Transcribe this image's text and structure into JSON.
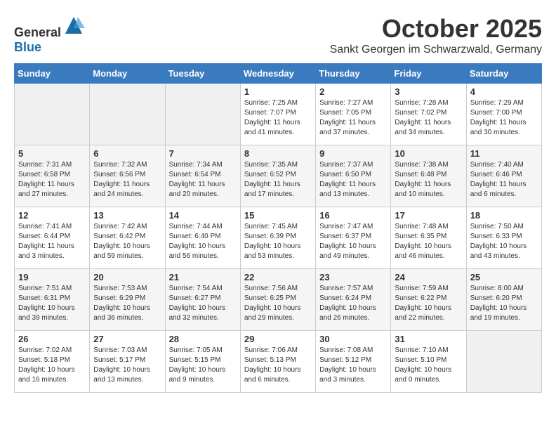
{
  "logo": {
    "text_general": "General",
    "text_blue": "Blue"
  },
  "header": {
    "month": "October 2025",
    "location": "Sankt Georgen im Schwarzwald, Germany"
  },
  "weekdays": [
    "Sunday",
    "Monday",
    "Tuesday",
    "Wednesday",
    "Thursday",
    "Friday",
    "Saturday"
  ],
  "weeks": [
    [
      {
        "day": "",
        "info": ""
      },
      {
        "day": "",
        "info": ""
      },
      {
        "day": "",
        "info": ""
      },
      {
        "day": "1",
        "info": "Sunrise: 7:25 AM\nSunset: 7:07 PM\nDaylight: 11 hours\nand 41 minutes."
      },
      {
        "day": "2",
        "info": "Sunrise: 7:27 AM\nSunset: 7:05 PM\nDaylight: 11 hours\nand 37 minutes."
      },
      {
        "day": "3",
        "info": "Sunrise: 7:28 AM\nSunset: 7:02 PM\nDaylight: 11 hours\nand 34 minutes."
      },
      {
        "day": "4",
        "info": "Sunrise: 7:29 AM\nSunset: 7:00 PM\nDaylight: 11 hours\nand 30 minutes."
      }
    ],
    [
      {
        "day": "5",
        "info": "Sunrise: 7:31 AM\nSunset: 6:58 PM\nDaylight: 11 hours\nand 27 minutes."
      },
      {
        "day": "6",
        "info": "Sunrise: 7:32 AM\nSunset: 6:56 PM\nDaylight: 11 hours\nand 24 minutes."
      },
      {
        "day": "7",
        "info": "Sunrise: 7:34 AM\nSunset: 6:54 PM\nDaylight: 11 hours\nand 20 minutes."
      },
      {
        "day": "8",
        "info": "Sunrise: 7:35 AM\nSunset: 6:52 PM\nDaylight: 11 hours\nand 17 minutes."
      },
      {
        "day": "9",
        "info": "Sunrise: 7:37 AM\nSunset: 6:50 PM\nDaylight: 11 hours\nand 13 minutes."
      },
      {
        "day": "10",
        "info": "Sunrise: 7:38 AM\nSunset: 6:48 PM\nDaylight: 11 hours\nand 10 minutes."
      },
      {
        "day": "11",
        "info": "Sunrise: 7:40 AM\nSunset: 6:46 PM\nDaylight: 11 hours\nand 6 minutes."
      }
    ],
    [
      {
        "day": "12",
        "info": "Sunrise: 7:41 AM\nSunset: 6:44 PM\nDaylight: 11 hours\nand 3 minutes."
      },
      {
        "day": "13",
        "info": "Sunrise: 7:42 AM\nSunset: 6:42 PM\nDaylight: 10 hours\nand 59 minutes."
      },
      {
        "day": "14",
        "info": "Sunrise: 7:44 AM\nSunset: 6:40 PM\nDaylight: 10 hours\nand 56 minutes."
      },
      {
        "day": "15",
        "info": "Sunrise: 7:45 AM\nSunset: 6:39 PM\nDaylight: 10 hours\nand 53 minutes."
      },
      {
        "day": "16",
        "info": "Sunrise: 7:47 AM\nSunset: 6:37 PM\nDaylight: 10 hours\nand 49 minutes."
      },
      {
        "day": "17",
        "info": "Sunrise: 7:48 AM\nSunset: 6:35 PM\nDaylight: 10 hours\nand 46 minutes."
      },
      {
        "day": "18",
        "info": "Sunrise: 7:50 AM\nSunset: 6:33 PM\nDaylight: 10 hours\nand 43 minutes."
      }
    ],
    [
      {
        "day": "19",
        "info": "Sunrise: 7:51 AM\nSunset: 6:31 PM\nDaylight: 10 hours\nand 39 minutes."
      },
      {
        "day": "20",
        "info": "Sunrise: 7:53 AM\nSunset: 6:29 PM\nDaylight: 10 hours\nand 36 minutes."
      },
      {
        "day": "21",
        "info": "Sunrise: 7:54 AM\nSunset: 6:27 PM\nDaylight: 10 hours\nand 32 minutes."
      },
      {
        "day": "22",
        "info": "Sunrise: 7:56 AM\nSunset: 6:25 PM\nDaylight: 10 hours\nand 29 minutes."
      },
      {
        "day": "23",
        "info": "Sunrise: 7:57 AM\nSunset: 6:24 PM\nDaylight: 10 hours\nand 26 minutes."
      },
      {
        "day": "24",
        "info": "Sunrise: 7:59 AM\nSunset: 6:22 PM\nDaylight: 10 hours\nand 22 minutes."
      },
      {
        "day": "25",
        "info": "Sunrise: 8:00 AM\nSunset: 6:20 PM\nDaylight: 10 hours\nand 19 minutes."
      }
    ],
    [
      {
        "day": "26",
        "info": "Sunrise: 7:02 AM\nSunset: 5:18 PM\nDaylight: 10 hours\nand 16 minutes."
      },
      {
        "day": "27",
        "info": "Sunrise: 7:03 AM\nSunset: 5:17 PM\nDaylight: 10 hours\nand 13 minutes."
      },
      {
        "day": "28",
        "info": "Sunrise: 7:05 AM\nSunset: 5:15 PM\nDaylight: 10 hours\nand 9 minutes."
      },
      {
        "day": "29",
        "info": "Sunrise: 7:06 AM\nSunset: 5:13 PM\nDaylight: 10 hours\nand 6 minutes."
      },
      {
        "day": "30",
        "info": "Sunrise: 7:08 AM\nSunset: 5:12 PM\nDaylight: 10 hours\nand 3 minutes."
      },
      {
        "day": "31",
        "info": "Sunrise: 7:10 AM\nSunset: 5:10 PM\nDaylight: 10 hours\nand 0 minutes."
      },
      {
        "day": "",
        "info": ""
      }
    ]
  ]
}
